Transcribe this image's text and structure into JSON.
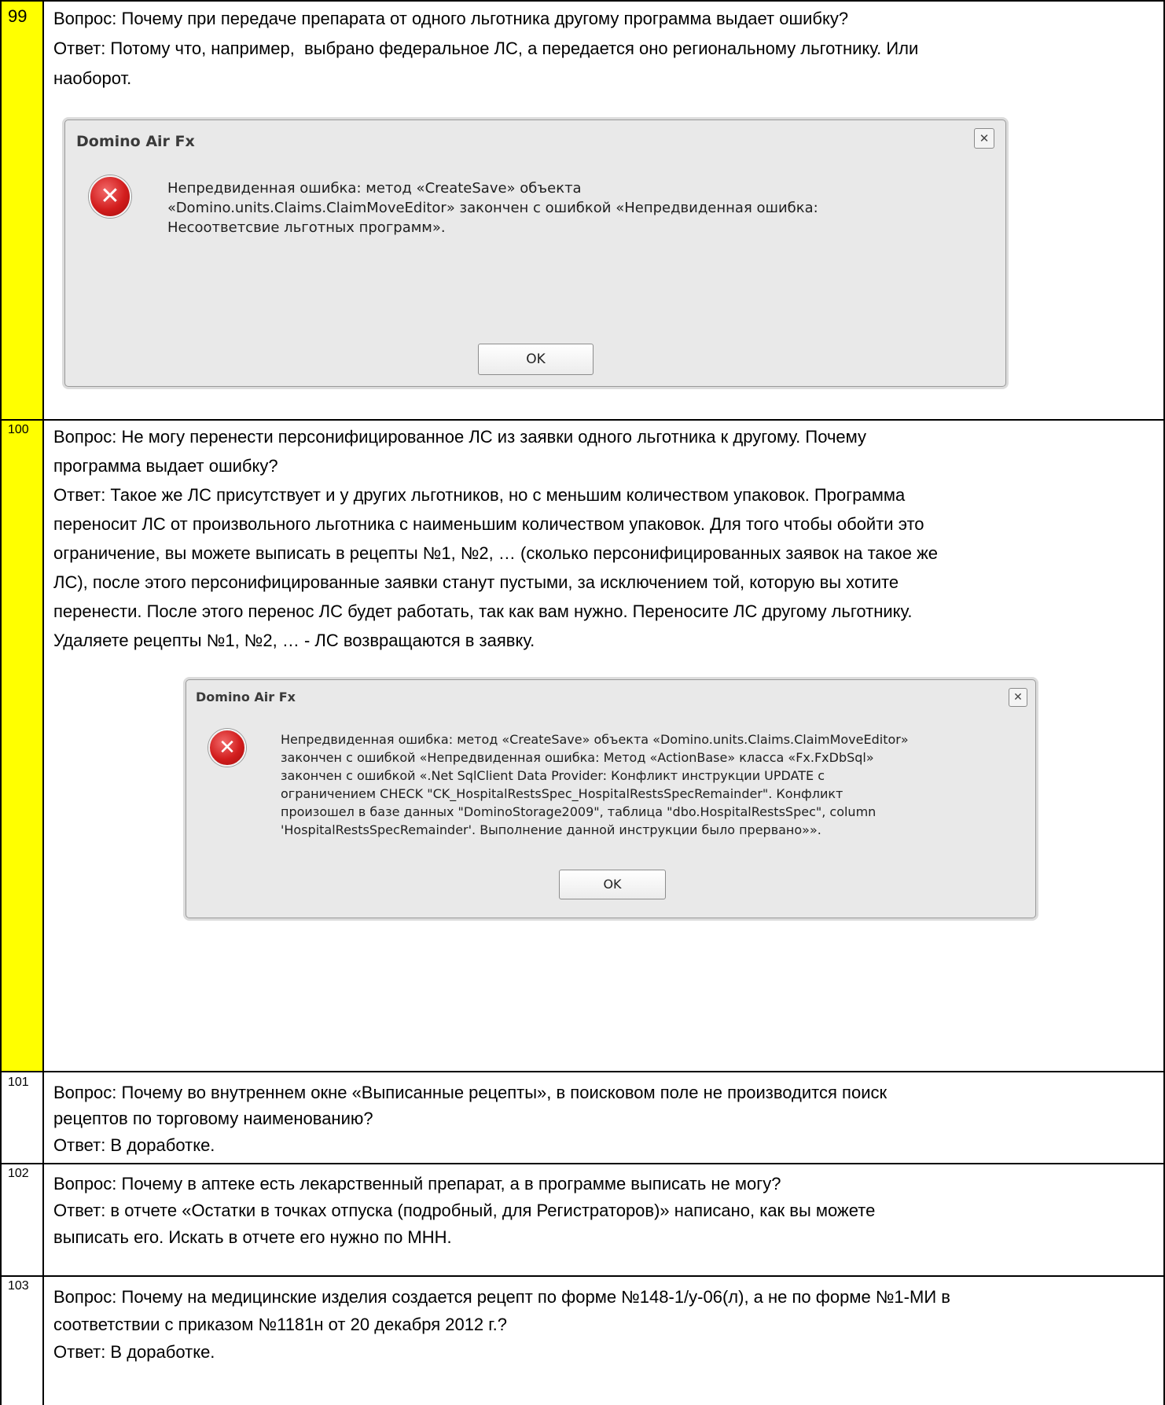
{
  "rows": [
    {
      "number": "99",
      "question": "Вопрос: Почему при передаче препарата от одного льготника другому программа выдает ошибку?",
      "answer_lines": [
        "Ответ: Потому что, например,  выбрано федеральное ЛС, а передается оно региональному льготнику. Или",
        "наоборот."
      ],
      "dialog": {
        "title": "Domino Air Fx",
        "close": "✕",
        "icon": "error-icon",
        "message_lines": [
          "Непредвиденная ошибка: метод «CreateSave» объекта",
          "«Domino.units.Claims.ClaimMoveEditor» закончен с ошибкой «Непредвиденная ошибка:",
          "Несоответсвие льготных программ»."
        ],
        "ok": "OK"
      }
    },
    {
      "number": "100",
      "question_lines": [
        "Вопрос: Не могу перенести персонифицированное ЛС из заявки одного льготника к другому. Почему",
        "программа выдает ошибку?"
      ],
      "answer_lines": [
        "Ответ: Такое же ЛС присутствует и у других льготников, но с меньшим количеством упаковок. Программа",
        "переносит ЛС от произвольного льготника с наименьшим количеством упаковок. Для того чтобы обойти это",
        "ограничение, вы можете выписать в рецепты №1, №2, … (сколько персонифицированных заявок на такое же",
        "ЛС), после этого персонифицированные заявки станут пустыми, за исключением той, которую вы хотите",
        "перенести. После этого перенос ЛС будет работать, так как вам нужно. Переносите ЛС другому льготнику.",
        "Удаляете рецепты №1, №2, … - ЛС возвращаются в заявку."
      ],
      "dialog": {
        "title": "Domino Air Fx",
        "close": "✕",
        "icon": "error-icon",
        "message_lines": [
          "Непредвиденная ошибка: метод «CreateSave» объекта «Domino.units.Claims.ClaimMoveEditor»",
          "закончен с ошибкой «Непредвиденная ошибка: Метод «ActionBase» класса «Fx.FxDbSql»",
          "закончен с ошибкой «.Net SqlClient Data Provider: Конфликт инструкции UPDATE с",
          "ограничением CHECK \"CK_HospitalRestsSpec_HospitalRestsSpecRemainder\". Конфликт",
          "произошел в базе данных \"DominoStorage2009\", таблица \"dbo.HospitalRestsSpec\", column",
          "'HospitalRestsSpecRemainder'. Выполнение данной инструкции было прервано»»."
        ],
        "ok": "OK"
      }
    },
    {
      "number": "101",
      "question_lines": [
        "Вопрос: Почему во внутреннем окне «Выписанные рецепты», в поисковом поле не производится поиск",
        "рецептов по торговому наименованию?"
      ],
      "answer": "Ответ: В доработке."
    },
    {
      "number": "102",
      "question": "Вопрос: Почему в аптеке есть лекарственный препарат, а в программе выписать не могу?",
      "answer_lines": [
        "Ответ: в отчете «Остатки в точках отпуска (подробный, для Регистраторов)» написано, как вы можете",
        "выписать его. Искать в отчете его нужно по МНН."
      ]
    },
    {
      "number": "103",
      "question_lines": [
        "Вопрос: Почему на медицинские изделия создается рецепт по форме №148-1/у-06(л), а не по форме №1-МИ в",
        "соответствии с приказом №1181н от 20 декабря 2012 г.?"
      ],
      "answer": "Ответ: В доработке."
    }
  ]
}
